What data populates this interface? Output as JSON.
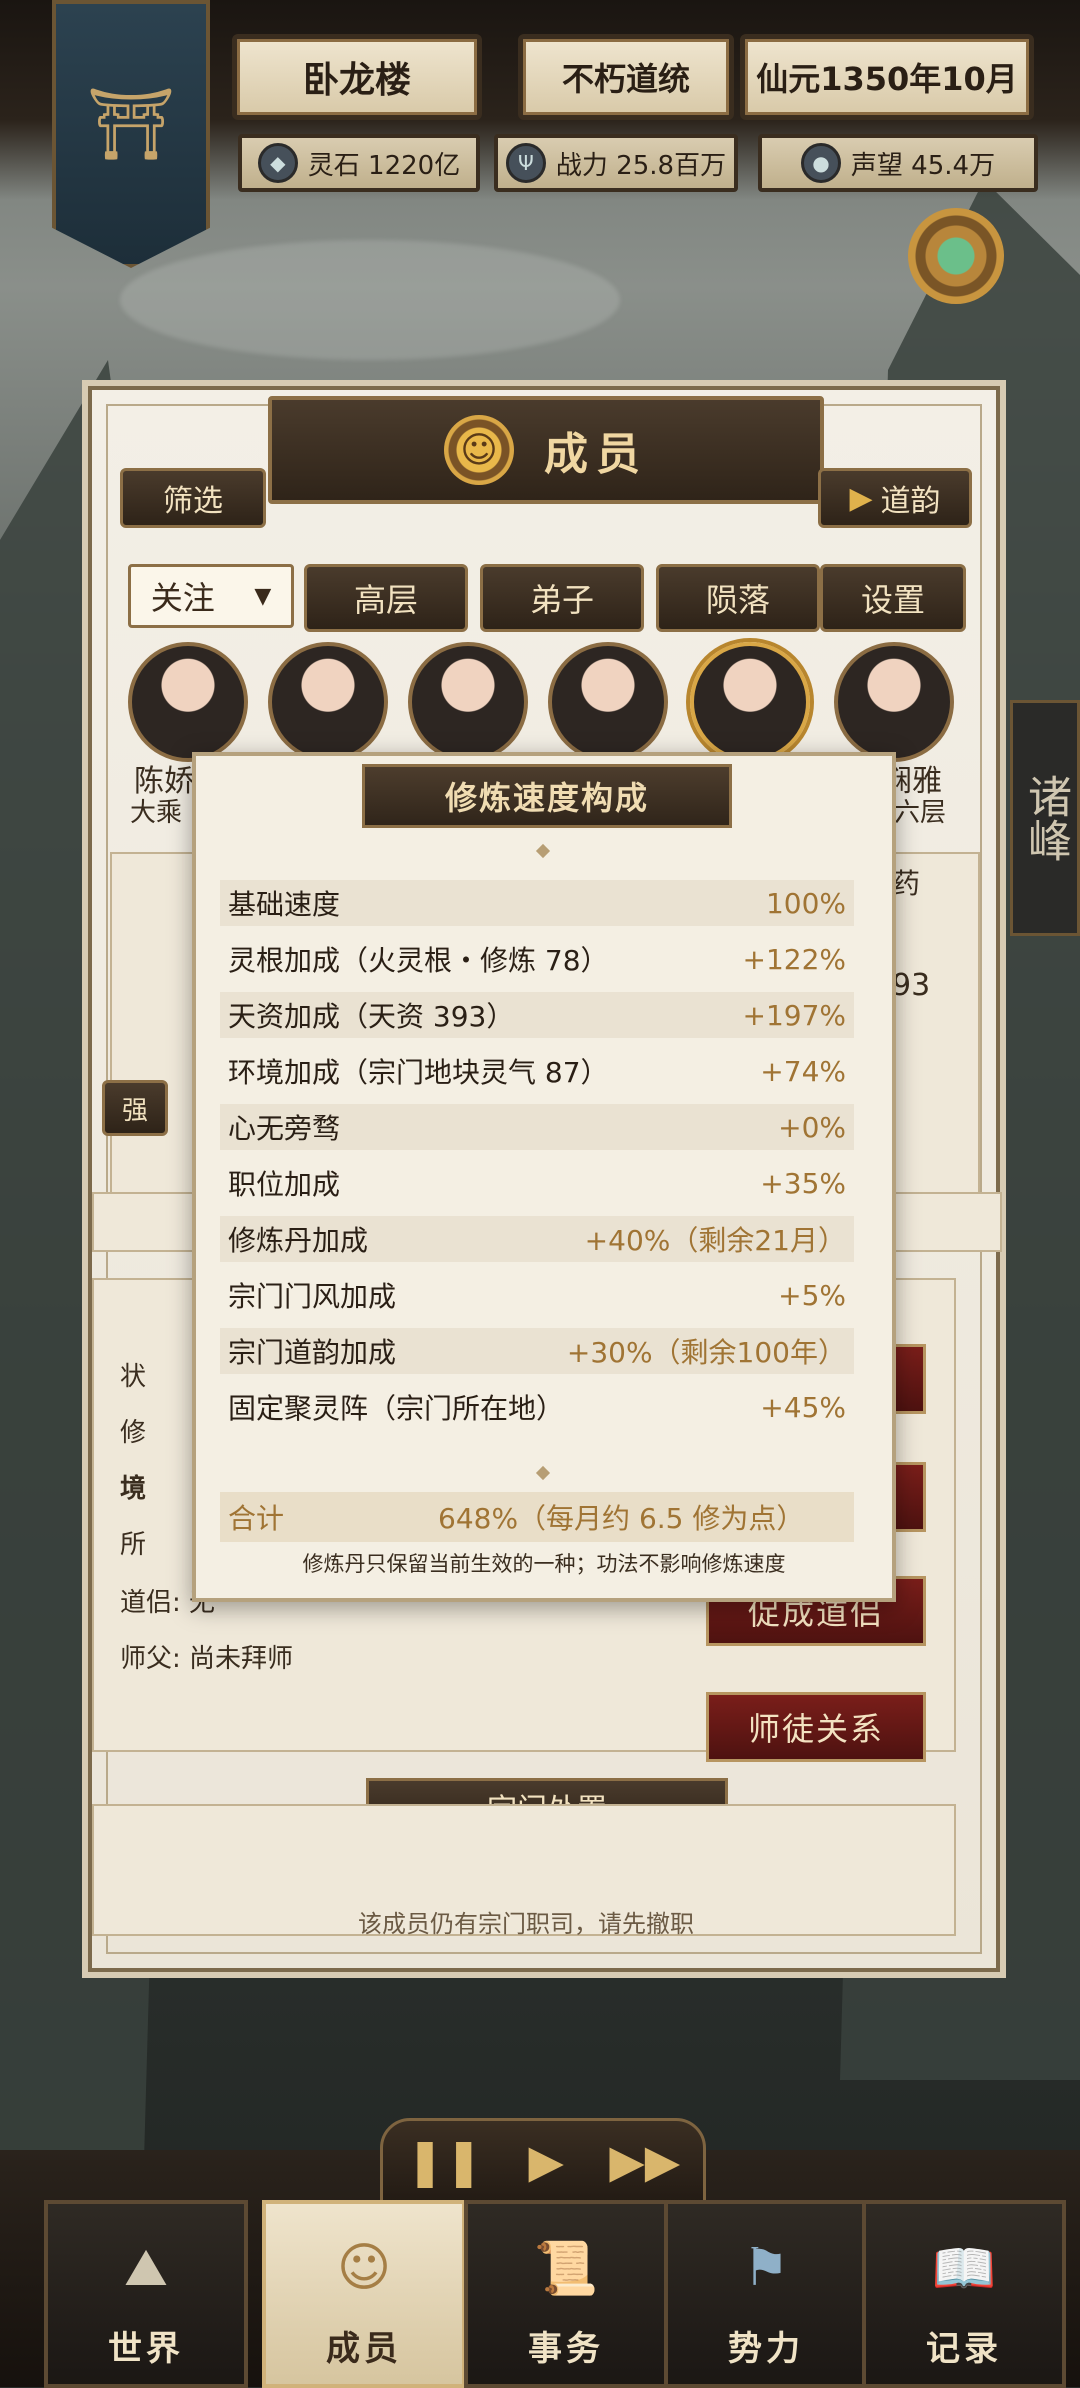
{
  "hud": {
    "location": "卧龙楼",
    "sect": "不朽道统",
    "date": "仙元1350年10月",
    "spirit_stones": "灵石 1220亿",
    "power": "战力 25.8百万",
    "prestige": "声望 45.4万"
  },
  "side_tab": "诸峰",
  "panel": {
    "title": "成员",
    "filter_btn": "筛选",
    "daoyun_btn": "道韵",
    "follow_select": "关注",
    "tabs": [
      "高层",
      "弟子",
      "陨落",
      "设置"
    ],
    "members": [
      {
        "name": "陈娇",
        "realm": "大乘"
      },
      {
        "name": "",
        "realm": ""
      },
      {
        "name": "",
        "realm": ""
      },
      {
        "name": "",
        "realm": ""
      },
      {
        "name": "",
        "realm": ""
      },
      {
        "name": "娴雅",
        "realm": "六层"
      }
    ],
    "detail": {
      "partner": "道侣: 无",
      "master": "师父: 尚未拜师",
      "partial_labels": [
        "状",
        "修",
        "境",
        "所"
      ],
      "num_fragment": "93",
      "tag_fragment": "药",
      "btn_partial": "强"
    },
    "buttons": {
      "promote_partner": "促成道侣",
      "master_disciple": "师徒关系"
    },
    "sect_disposal": "宗门处置",
    "bottom_hint": "该成员仍有宗门职司，请先撤职"
  },
  "overlay": {
    "title": "修炼速度构成",
    "rows": [
      {
        "label": "基础速度",
        "value": "100%"
      },
      {
        "label": "灵根加成（火灵根・修炼 78）",
        "value": "+122%"
      },
      {
        "label": "天资加成（天资 393）",
        "value": "+197%"
      },
      {
        "label": "环境加成（宗门地块灵气 87）",
        "value": "+74%"
      },
      {
        "label": "心无旁骛",
        "value": "+0%"
      },
      {
        "label": "职位加成",
        "value": "+35%"
      },
      {
        "label": "修炼丹加成",
        "value": "+40%（剩余21月）"
      },
      {
        "label": "宗门门风加成",
        "value": "+5%"
      },
      {
        "label": "宗门道韵加成",
        "value": "+30%（剩余100年）"
      },
      {
        "label": "固定聚灵阵（宗门所在地）",
        "value": "+45%"
      }
    ],
    "total_label": "合计",
    "total_value": "648%（每月约 6.5 修为点）",
    "note": "修炼丹只保留当前生效的一种；功法不影响修炼速度"
  },
  "nav": [
    {
      "label": "世界",
      "icon": "world-icon"
    },
    {
      "label": "成员",
      "icon": "member-icon"
    },
    {
      "label": "事务",
      "icon": "scroll-icon"
    },
    {
      "label": "势力",
      "icon": "flag-icon"
    },
    {
      "label": "记录",
      "icon": "book-icon"
    }
  ],
  "playback": {
    "pause": "pause-icon",
    "play": "play-icon",
    "fast": "fast-forward-icon"
  }
}
